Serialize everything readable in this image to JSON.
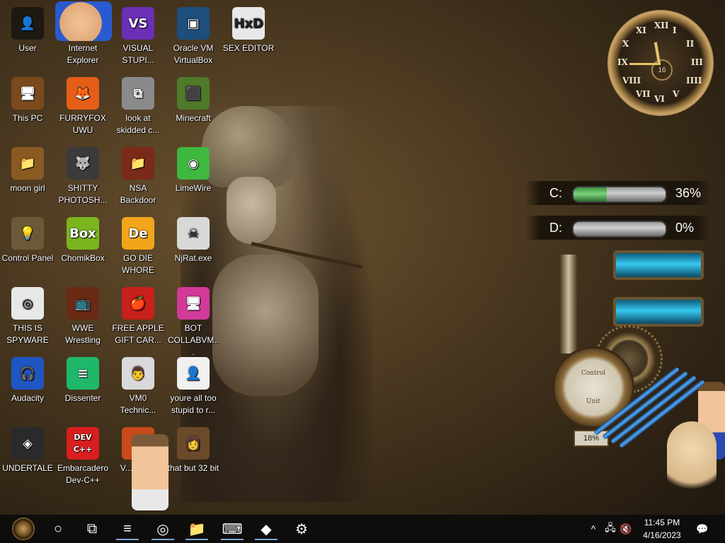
{
  "desktop": {
    "icons": [
      {
        "label": "User",
        "glyph": "👤",
        "bg": "#1e1812"
      },
      {
        "label": "Internet Explorer",
        "glyph": "e",
        "bg": "#2b6fd1"
      },
      {
        "label": "VISUAL STUPI...",
        "glyph": "VS",
        "bg": "#6a2fb5"
      },
      {
        "label": "Oracle VM VirtualBox",
        "glyph": "▣",
        "bg": "#1d4e7c"
      },
      {
        "label": "SEX EDITOR",
        "glyph": "HxD",
        "bg": "#e8e8e8"
      },
      {
        "label": "This PC",
        "glyph": "🖥",
        "bg": "#7a4a1c"
      },
      {
        "label": "FURRYFOX UWU",
        "glyph": "🦊",
        "bg": "#e55e18"
      },
      {
        "label": "look at skidded c...",
        "glyph": "⧉",
        "bg": "#8a8a8a"
      },
      {
        "label": "Minecraft",
        "glyph": "⬛",
        "bg": "#4f7a2a"
      },
      {
        "label": "moon girl",
        "glyph": "📁",
        "bg": "#8a5a22"
      },
      {
        "label": "SHITTY PHOTOSH...",
        "glyph": "🐺",
        "bg": "#3b3b3b"
      },
      {
        "label": "NSA Backdoor",
        "glyph": "📁",
        "bg": "#7a2a18"
      },
      {
        "label": "LimeWire",
        "glyph": "◉",
        "bg": "#3fb83f"
      },
      {
        "label": "Control Panel",
        "glyph": "💡",
        "bg": "#6b5a3a"
      },
      {
        "label": "ChomikBox",
        "glyph": "Box",
        "bg": "#7bb51e"
      },
      {
        "label": "GO DIE WHORE",
        "glyph": "De",
        "bg": "#f2a51a"
      },
      {
        "label": "NjRat.exe",
        "glyph": "☠",
        "bg": "#d8d8d8"
      },
      {
        "label": "THIS IS SPYWARE",
        "glyph": "◎",
        "bg": "#e8e8e8"
      },
      {
        "label": "WWE Wrestling",
        "glyph": "📺",
        "bg": "#6b2a14"
      },
      {
        "label": "FREE APPLE GIFT CAR...",
        "glyph": "🍎",
        "bg": "#c8201a"
      },
      {
        "label": "BOT COLLABVM...",
        "glyph": "🖥",
        "bg": "#d23a9a"
      },
      {
        "label": "Audacity",
        "glyph": "🎧",
        "bg": "#1f56c2"
      },
      {
        "label": "Dissenter",
        "glyph": "≡",
        "bg": "#1fb86b"
      },
      {
        "label": "VM0 Technic...",
        "glyph": "👨",
        "bg": "#d9d9d9"
      },
      {
        "label": "youre all too stupid to r...",
        "glyph": "👤",
        "bg": "#f0f0f0"
      },
      {
        "label": "UNDERTALE",
        "glyph": "◈",
        "bg": "#2a2a2a"
      },
      {
        "label": "Embarcadero Dev-C++",
        "glyph": "DEV C++",
        "bg": "#d81e1e"
      },
      {
        "label": "V... Anti...",
        "glyph": "🛡",
        "bg": "#c84a1a"
      },
      {
        "label": "that but 32 bit",
        "glyph": "👩",
        "bg": "#6b4a2a"
      }
    ]
  },
  "clock_widget": {
    "numerals": [
      "XII",
      "I",
      "II",
      "III",
      "IIII",
      "V",
      "VI",
      "VII",
      "VIII",
      "IX",
      "X",
      "XI"
    ],
    "center_value": "16"
  },
  "drives": [
    {
      "letter": "C:",
      "percent_text": "36%",
      "fill": 0.36
    },
    {
      "letter": "D:",
      "percent_text": "0%",
      "fill": 0.0
    }
  ],
  "pipes_widget": {
    "gauge_title": "Control",
    "gauge_sub": "Unit",
    "gauge_percent": "18%"
  },
  "taskbar": {
    "start_icon": "gear-start-icon",
    "buttons": [
      {
        "name": "cortana-button",
        "glyph": "○"
      },
      {
        "name": "task-view-button",
        "glyph": "⧉"
      },
      {
        "name": "dissenter-taskbar-button",
        "glyph": "≡"
      },
      {
        "name": "chrome-taskbar-button",
        "glyph": "◎"
      },
      {
        "name": "file-explorer-taskbar-button",
        "glyph": "📁"
      },
      {
        "name": "keyboard-app-taskbar-button",
        "glyph": "⌨"
      },
      {
        "name": "anydesk-taskbar-button",
        "glyph": "◆"
      },
      {
        "name": "settings-taskbar-button",
        "glyph": "⚙"
      }
    ],
    "tray": {
      "chevron": "^",
      "network": "🖧",
      "volume": "🔇",
      "time": "11:45 PM",
      "date": "4/16/2023",
      "notifications": "💬"
    }
  },
  "colors": {
    "taskbar_bg": "#0f0d0c",
    "drive_fill": "#5cbf5c",
    "pipe_glass": "#36c8f0"
  }
}
